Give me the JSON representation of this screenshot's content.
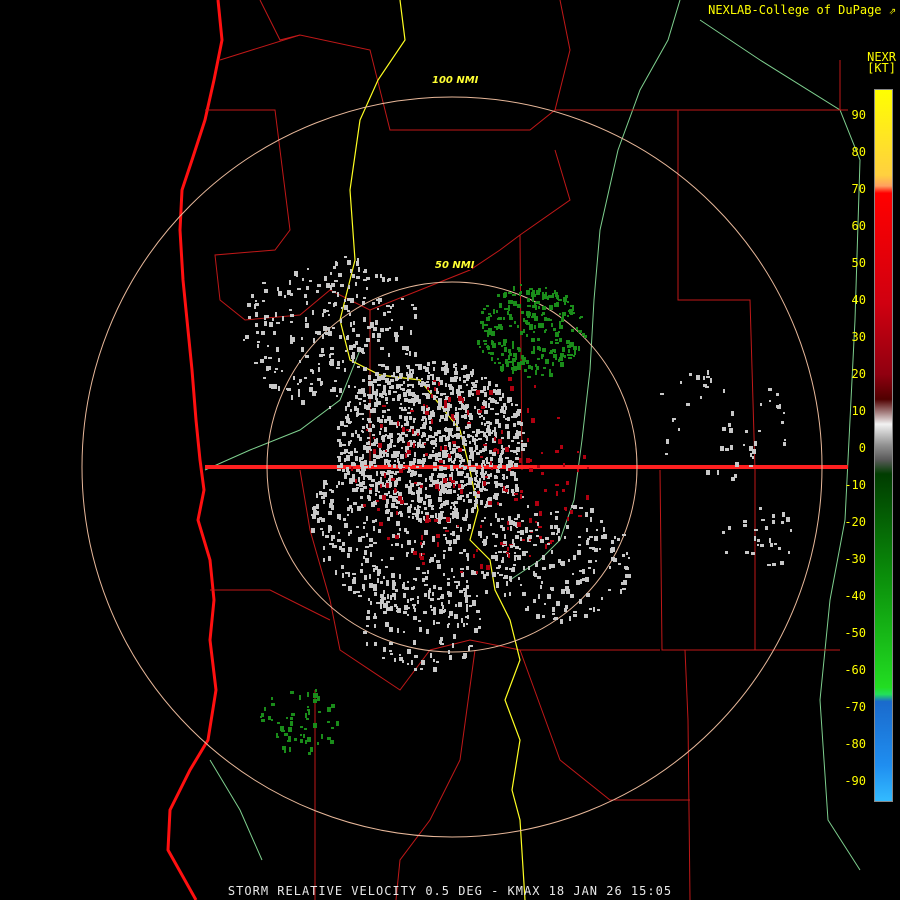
{
  "credit": "NEXLAB-College of DuPage",
  "product": {
    "code": "NEXR",
    "unit": "[KT]"
  },
  "range_rings": [
    "100 NMI",
    "50 NMI"
  ],
  "colorbar": {
    "ticks": [
      "90",
      "80",
      "70",
      "60",
      "50",
      "40",
      "30",
      "20",
      "10",
      "0",
      "-10",
      "-20",
      "-30",
      "-40",
      "-50",
      "-60",
      "-70",
      "-80",
      "-90"
    ]
  },
  "footer": "STORM RELATIVE VELOCITY 0.5 DEG - KMAX 18 JAN 26 15:05",
  "colors": {
    "coastline": "#ff1010",
    "county_lines": "#c01818",
    "state_line": "#ffff22",
    "rivers": "#7ecf8e",
    "range_ring": "#e8b89a",
    "inbound": "#1a8c1a",
    "outbound": "#b00010",
    "near_zero": "#c8c8c8"
  }
}
